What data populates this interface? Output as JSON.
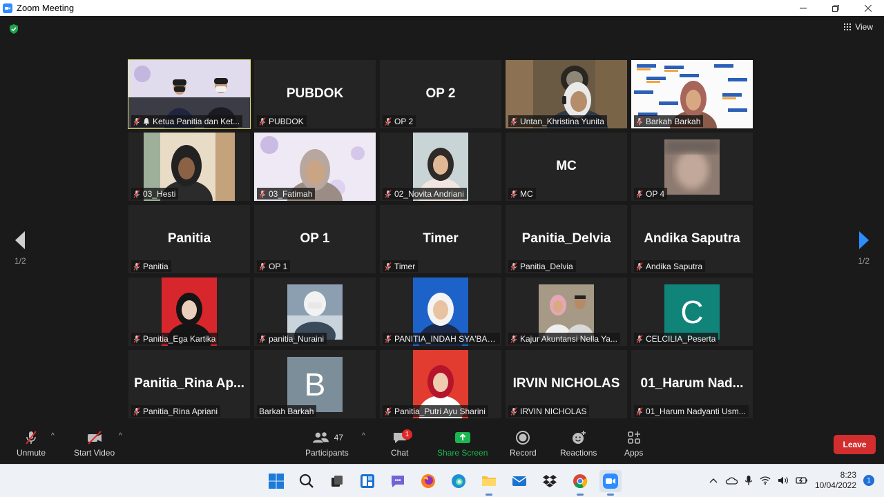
{
  "window": {
    "title": "Zoom Meeting",
    "controls": [
      "minimize",
      "maximize",
      "close"
    ]
  },
  "meeting": {
    "view_label": "View",
    "page_indicator_left": "1/2",
    "page_indicator_right": "1/2",
    "tiles": [
      {
        "label": "Ketua Panitia dan Ket...",
        "display_name": "",
        "video": "banner-two"
      },
      {
        "label": "PUBDOK",
        "display_name": "PUBDOK",
        "video": ""
      },
      {
        "label": "OP 2",
        "display_name": "OP 2",
        "video": ""
      },
      {
        "label": "Untan_Khristina Yunita",
        "display_name": "",
        "video": "woman-headset"
      },
      {
        "label": "Barkah Barkah",
        "display_name": "",
        "video": "kampus-merdeka"
      },
      {
        "label": "03_Hesti",
        "display_name": "",
        "video": "hesti"
      },
      {
        "label": "03_Fatimah",
        "display_name": "",
        "video": "banner-one"
      },
      {
        "label": "02_Novita Andriani",
        "display_name": "",
        "video": "novita"
      },
      {
        "label": "MC",
        "display_name": "MC",
        "video": ""
      },
      {
        "label": "OP 4",
        "display_name": "",
        "video": "blur"
      },
      {
        "label": "Panitia",
        "display_name": "Panitia",
        "video": ""
      },
      {
        "label": "OP 1",
        "display_name": "OP 1",
        "video": ""
      },
      {
        "label": "Timer",
        "display_name": "Timer",
        "video": ""
      },
      {
        "label": "Panitia_Delvia",
        "display_name": "Panitia_Delvia",
        "video": ""
      },
      {
        "label": "Andika Saputra",
        "display_name": "Andika Saputra",
        "video": ""
      },
      {
        "label": "Panitia_Ega Kartika",
        "display_name": "",
        "video": "ega"
      },
      {
        "label": "panitia_Nuraini",
        "display_name": "",
        "video": "nuraini"
      },
      {
        "label": "PANITIA_INDAH SYA'BAN...",
        "display_name": "",
        "video": "indah"
      },
      {
        "label": "Kajur Akuntansi Nella Ya...",
        "display_name": "",
        "video": "kajur"
      },
      {
        "label": "CELCILIA_Peserta",
        "display_name": "",
        "avatar_letter": "C",
        "avatar_color": "#11847a"
      },
      {
        "label": "Panitia_Rina Apriani",
        "display_name": "Panitia_Rina  Ap...",
        "video": ""
      },
      {
        "label": "Barkah Barkah",
        "display_name": "",
        "avatar_letter": "B",
        "avatar_color": "#7b8e99"
      },
      {
        "label": "Panitia_Putri Ayu Sharini",
        "display_name": "",
        "video": "putri"
      },
      {
        "label": "IRVIN NICHOLAS",
        "display_name": "IRVIN NICHOLAS",
        "video": ""
      },
      {
        "label": "01_Harum Nadyanti Usm...",
        "display_name": "01_Harum  Nad...",
        "video": ""
      }
    ]
  },
  "toolbar": {
    "unmute_label": "Unmute",
    "start_video_label": "Start Video",
    "participants_label": "Participants",
    "participants_count": "47",
    "chat_label": "Chat",
    "chat_badge": "1",
    "share_screen_label": "Share Screen",
    "record_label": "Record",
    "reactions_label": "Reactions",
    "apps_label": "Apps",
    "leave_label": "Leave"
  },
  "taskbar": {
    "time": "8:23",
    "date": "10/04/2022",
    "notifications": "1"
  },
  "colors": {
    "accent_green": "#19b74f",
    "leave_red": "#d32e2e",
    "active_speaker": "#e8e46a"
  }
}
